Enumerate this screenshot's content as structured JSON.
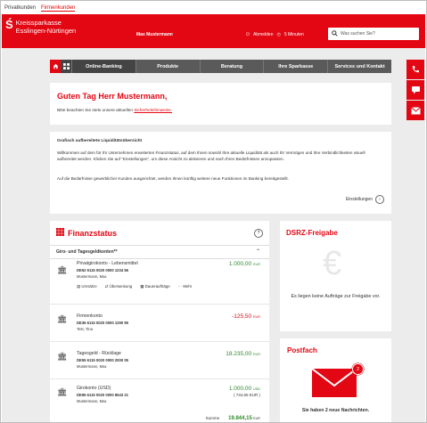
{
  "audience_tabs": [
    {
      "label": "Privatkunden",
      "active": false
    },
    {
      "label": "Firmenkunden",
      "active": true
    }
  ],
  "header": {
    "logo_line1": "Kreissparkasse",
    "logo_line2": "Esslingen-Nürtingen",
    "user_name": "Max Mustermann",
    "logout_label": "Abmelden",
    "timer_label": "5 Minuten",
    "search_placeholder": "Was suchen Sie?"
  },
  "nav": {
    "items": [
      "Online-Banking",
      "Produkte",
      "Beratung",
      "Ihre Sparkasse",
      "Services und Kontakt"
    ],
    "active": "Online-Banking"
  },
  "greeting": {
    "title": "Guten Tag Herr Mustermann,",
    "text_prefix": "Bitte beachten Sie stets unsere aktuellen",
    "link": "Sicherheitshinweise."
  },
  "info": {
    "title": "Grafisch aufbereitete Liquiditätsübersicht",
    "paragraph1": "Willkommen auf dem für Ihr Unternehmen erweiterten Finanzstatus, auf dem Ihnen sowohl Ihre aktuelle Liquidität als auch Ihr Vermögen und Ihre Verbindlichkeiten visuell aufbereitet werden. Klicken Sie auf \"Einstellungen\", um diese Ansicht zu aktivieren und nach Ihren Bedürfnissen anzupassen.",
    "paragraph2": "Auf die Bedürfnisse gewerblicher Kunden ausgerichtet, werden Ihnen künftig weitere neue Funktionen im Banking bereitgestellt.",
    "settings_label": "Einstellungen"
  },
  "finanzstatus": {
    "title": "Finanzstatus",
    "section_label": "Giro- und Tagesgeldkonten**",
    "accounts": [
      {
        "name": "Privatgirokonto - Lebensmittel",
        "iban": "DE52 6115 0020 0000 1234 56",
        "holder": "Mustermann, Max",
        "amount": "1.000,00",
        "currency": "EUR",
        "sign": "pos",
        "sub": ""
      },
      {
        "name": "Firmenkonto",
        "iban": "DE36 6115 0020 0000 1290 95",
        "holder": "Test, Tina",
        "amount": "-125,50",
        "currency": "EUR",
        "sign": "neg",
        "sub": ""
      },
      {
        "name": "Tagesgeld - Rücklage",
        "iban": "DE55 6115 0020 0000 2000 05",
        "holder": "Mustermann, Max",
        "amount": "18.235,00",
        "currency": "EUR",
        "sign": "pos",
        "sub": ""
      },
      {
        "name": "Girokonto (USD)",
        "iban": "DE96 6115 0020 0000 8543 21",
        "holder": "Mustermann, Max",
        "amount": "1.000,00",
        "currency": "USD",
        "sign": "pos",
        "sub": "( 734,65 EUR )"
      }
    ],
    "actions": [
      "Umsätze",
      "Überweisung",
      "Daueraufträge",
      "Mehr"
    ],
    "sum_label": "Summe",
    "sum_value": "19.844,15",
    "sum_currency": "EUR"
  },
  "dsrz": {
    "title": "DSRZ-Freigabe",
    "text": "Es liegen keine Aufträge zur Freigabe vor."
  },
  "postfach": {
    "title": "Postfach",
    "badge_count": "2",
    "text": "Sie haben 2 neue Nachrichten."
  },
  "side_buttons": [
    "phone-icon",
    "chat-icon",
    "mail-icon"
  ],
  "colors": {
    "brand": "#e30613",
    "positive": "#2e8b2e",
    "nav_bg": "#5a5a5a"
  }
}
